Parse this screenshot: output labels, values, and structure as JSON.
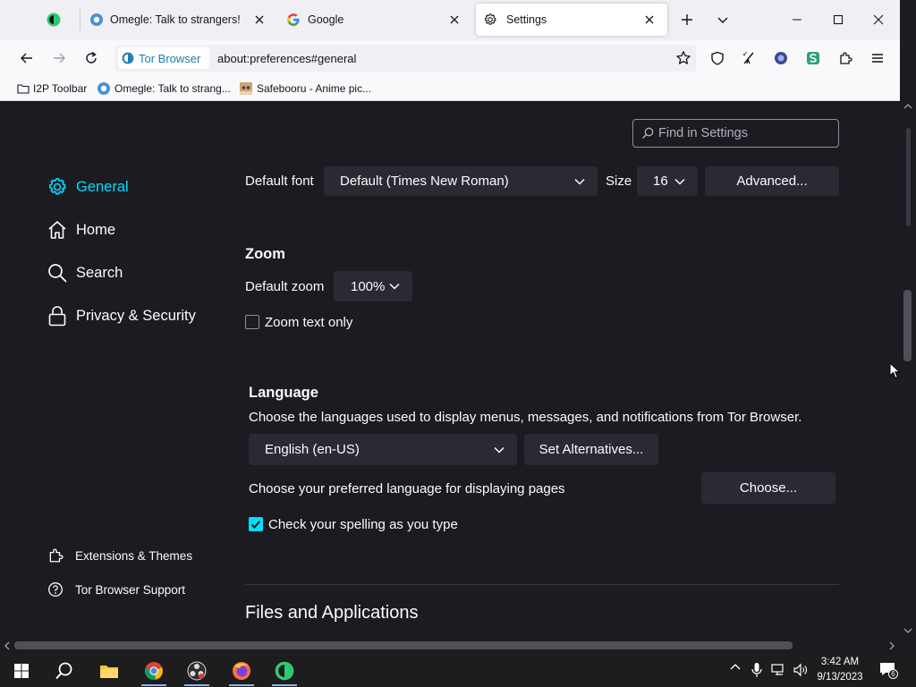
{
  "browser": {
    "tabs": [
      {
        "title": "Omegle: Talk to strangers!"
      },
      {
        "title": "Google"
      },
      {
        "title": "Settings"
      }
    ],
    "identity_label": "Tor Browser",
    "url": "about:preferences#general",
    "bookmarks": [
      "I2P Toolbar",
      "Omegle: Talk to strang...",
      "Safebooru - Anime pic..."
    ]
  },
  "settings": {
    "search_placeholder": "Find in Settings",
    "categories": [
      {
        "label": "General",
        "icon": "gear-icon",
        "selected": true
      },
      {
        "label": "Home",
        "icon": "home-icon"
      },
      {
        "label": "Search",
        "icon": "search-icon"
      },
      {
        "label": "Privacy & Security",
        "icon": "lock-icon"
      }
    ],
    "footer": [
      {
        "label": "Extensions & Themes",
        "icon": "puzzle-icon"
      },
      {
        "label": "Tor Browser Support",
        "icon": "help-icon"
      }
    ],
    "fonts": {
      "default_font_label": "Default font",
      "default_font_value": "Default (Times New Roman)",
      "size_label": "Size",
      "size_value": "16",
      "advanced_button": "Advanced..."
    },
    "zoom": {
      "heading": "Zoom",
      "default_zoom_label": "Default zoom",
      "default_zoom_value": "100%",
      "zoom_text_only_label": "Zoom text only",
      "zoom_text_only_checked": false
    },
    "language": {
      "heading": "Language",
      "description": "Choose the languages used to display menus, messages, and notifications from Tor Browser.",
      "selected": "English (en-US)",
      "set_alternatives_button": "Set Alternatives...",
      "pages_label": "Choose your preferred language for displaying pages",
      "choose_button": "Choose...",
      "spell_check_label": "Check your spelling as you type",
      "spell_check_checked": true
    },
    "next_section_heading": "Files and Applications"
  },
  "taskbar": {
    "time": "3:42 AM",
    "date": "9/13/2023",
    "notification_count": "6"
  },
  "colors": {
    "accent": "#00ddff",
    "page_bg": "#1c1b22",
    "button_bg": "#2b2a33"
  }
}
